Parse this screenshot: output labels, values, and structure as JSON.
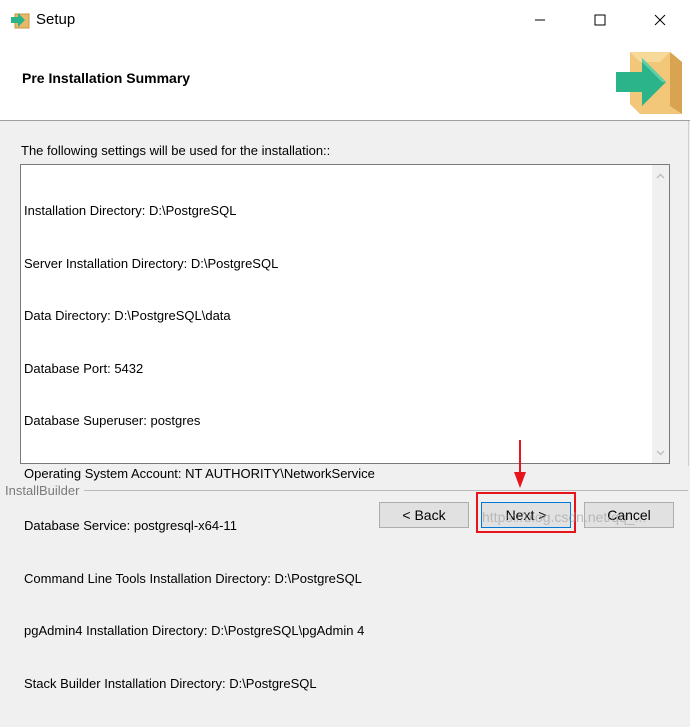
{
  "window": {
    "title": "Setup"
  },
  "header": {
    "title": "Pre Installation Summary"
  },
  "body": {
    "intro": "The following settings will be used for the installation::",
    "lines": [
      "Installation Directory: D:\\PostgreSQL",
      "Server Installation Directory: D:\\PostgreSQL",
      "Data Directory: D:\\PostgreSQL\\data",
      "Database Port: 5432",
      "Database Superuser: postgres",
      "Operating System Account: NT AUTHORITY\\NetworkService",
      "Database Service: postgresql-x64-11",
      "Command Line Tools Installation Directory: D:\\PostgreSQL",
      "pgAdmin4 Installation Directory: D:\\PostgreSQL\\pgAdmin 4",
      "Stack Builder Installation Directory: D:\\PostgreSQL"
    ]
  },
  "footer": {
    "brand": "InstallBuilder",
    "back_label": "< Back",
    "next_label": "Next >",
    "cancel_label": "Cancel",
    "watermark": "https://blog.csdn.net/qq_..."
  },
  "colors": {
    "annotation_red": "#e8141b",
    "icon_green": "#2bb38a",
    "box_tan": "#e6b96a"
  },
  "icons": {
    "app": "installer-box-arrow-icon",
    "header": "installer-box-arrow-icon",
    "minimize": "minimize-icon",
    "maximize": "maximize-icon",
    "close": "close-icon",
    "scroll_up": "chevron-up-icon",
    "scroll_down": "chevron-down-icon"
  }
}
